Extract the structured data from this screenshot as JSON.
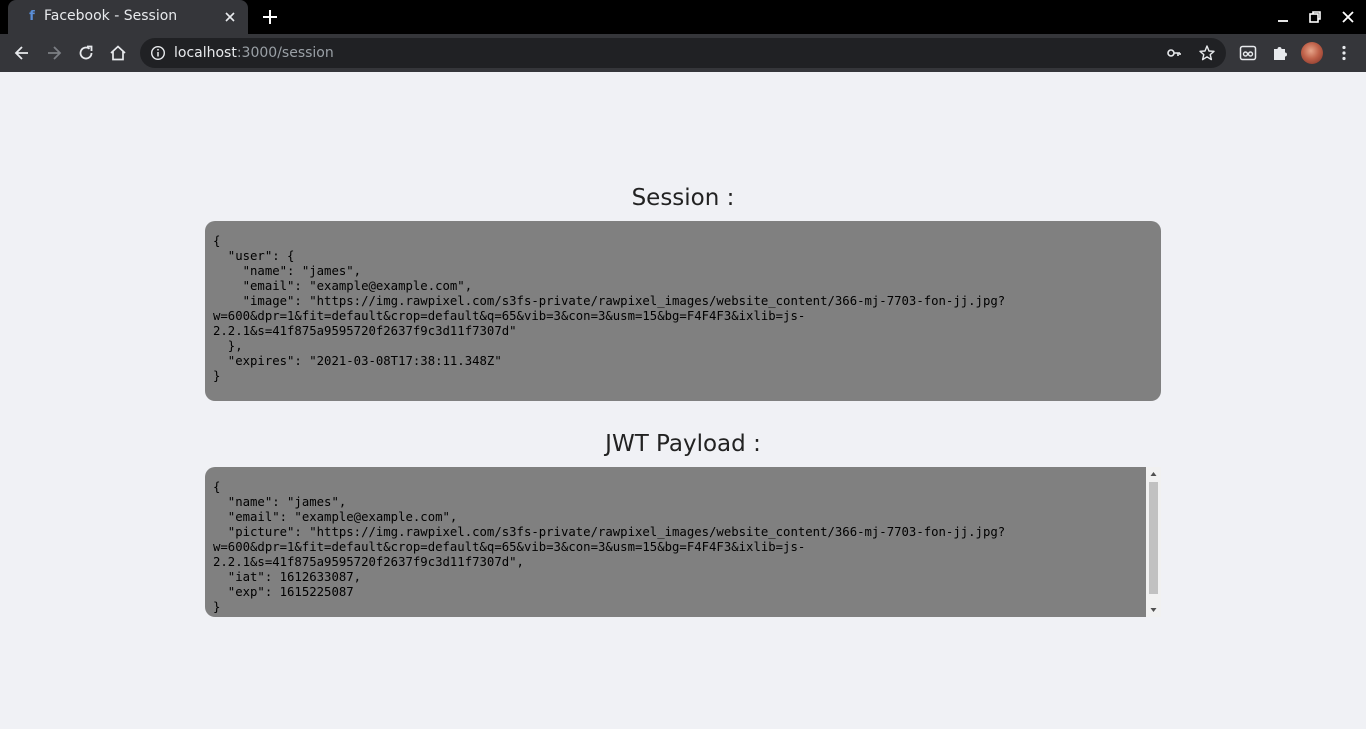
{
  "browser": {
    "tab": {
      "title": "Facebook - Session",
      "favicon": "facebook-icon"
    },
    "address": {
      "host": "localhost",
      "path": ":3000/session"
    }
  },
  "page": {
    "session_heading": "Session :",
    "session_lines": [
      "{",
      "  \"user\": {",
      "    \"name\": \"james\",",
      "    \"email\": \"example@example.com\",",
      "    \"image\": \"https://img.rawpixel.com/s3fs-private/rawpixel_images/website_content/366-mj-7703-fon-jj.jpg?",
      "w=600&dpr=1&fit=default&crop=default&q=65&vib=3&con=3&usm=15&bg=F4F4F3&ixlib=js-",
      "2.2.1&s=41f875a9595720f2637f9c3d11f7307d\"",
      "  },",
      "  \"expires\": \"2021-03-08T17:38:11.348Z\"",
      "}"
    ],
    "jwt_heading": "JWT Payload :",
    "jwt_lines": [
      "{",
      "  \"name\": \"james\",",
      "  \"email\": \"example@example.com\",",
      "  \"picture\": \"https://img.rawpixel.com/s3fs-private/rawpixel_images/website_content/366-mj-7703-fon-jj.jpg?",
      "w=600&dpr=1&fit=default&crop=default&q=65&vib=3&con=3&usm=15&bg=F4F4F3&ixlib=js-",
      "2.2.1&s=41f875a9595720f2637f9c3d11f7307d\",",
      "  \"iat\": 1612633087,",
      "  \"exp\": 1615225087",
      "}"
    ]
  }
}
